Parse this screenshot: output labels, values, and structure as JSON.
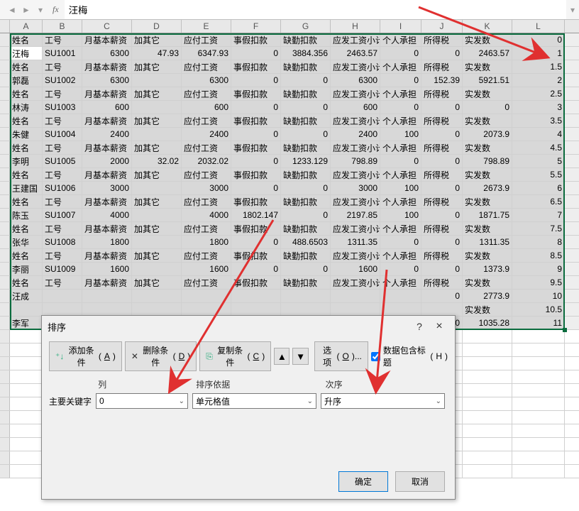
{
  "formula_bar": {
    "fx": "fx",
    "value": "汪梅"
  },
  "columns": [
    "A",
    "B",
    "C",
    "D",
    "E",
    "F",
    "G",
    "H",
    "I",
    "J",
    "K",
    "L"
  ],
  "data_headers": [
    "姓名",
    "工号",
    "月基本薪资",
    "加其它",
    "应付工资",
    "事假扣款",
    "缺勤扣款",
    "应发工资小计",
    "个人承担",
    "所得税",
    "实发数"
  ],
  "rows": [
    [
      "姓名",
      "工号",
      "月基本薪资",
      "加其它",
      "应付工资",
      "事假扣款",
      "缺勤扣款",
      "应发工资小计",
      "个人承担",
      "所得税",
      "实发数",
      "0"
    ],
    [
      "汪梅",
      "SU1001",
      "6300",
      "47.93",
      "6347.93",
      "0",
      "3884.356",
      "2463.57",
      "0",
      "0",
      "2463.57",
      "1"
    ],
    [
      "姓名",
      "工号",
      "月基本薪资",
      "加其它",
      "应付工资",
      "事假扣款",
      "缺勤扣款",
      "应发工资小计",
      "个人承担",
      "所得税",
      "实发数",
      "1.5"
    ],
    [
      "郭磊",
      "SU1002",
      "6300",
      "",
      "6300",
      "0",
      "0",
      "6300",
      "0",
      "152.39",
      "5921.51",
      "2"
    ],
    [
      "姓名",
      "工号",
      "月基本薪资",
      "加其它",
      "应付工资",
      "事假扣款",
      "缺勤扣款",
      "应发工资小计",
      "个人承担",
      "所得税",
      "实发数",
      "2.5"
    ],
    [
      "林涛",
      "SU1003",
      "600",
      "",
      "600",
      "0",
      "0",
      "600",
      "0",
      "0",
      "0",
      "3"
    ],
    [
      "姓名",
      "工号",
      "月基本薪资",
      "加其它",
      "应付工资",
      "事假扣款",
      "缺勤扣款",
      "应发工资小计",
      "个人承担",
      "所得税",
      "实发数",
      "3.5"
    ],
    [
      "朱健",
      "SU1004",
      "2400",
      "",
      "2400",
      "0",
      "0",
      "2400",
      "100",
      "0",
      "2073.9",
      "4"
    ],
    [
      "姓名",
      "工号",
      "月基本薪资",
      "加其它",
      "应付工资",
      "事假扣款",
      "缺勤扣款",
      "应发工资小计",
      "个人承担",
      "所得税",
      "实发数",
      "4.5"
    ],
    [
      "李明",
      "SU1005",
      "2000",
      "32.02",
      "2032.02",
      "0",
      "1233.129",
      "798.89",
      "0",
      "0",
      "798.89",
      "5"
    ],
    [
      "姓名",
      "工号",
      "月基本薪资",
      "加其它",
      "应付工资",
      "事假扣款",
      "缺勤扣款",
      "应发工资小计",
      "个人承担",
      "所得税",
      "实发数",
      "5.5"
    ],
    [
      "王建国",
      "SU1006",
      "3000",
      "",
      "3000",
      "0",
      "0",
      "3000",
      "100",
      "0",
      "2673.9",
      "6"
    ],
    [
      "姓名",
      "工号",
      "月基本薪资",
      "加其它",
      "应付工资",
      "事假扣款",
      "缺勤扣款",
      "应发工资小计",
      "个人承担",
      "所得税",
      "实发数",
      "6.5"
    ],
    [
      "陈玉",
      "SU1007",
      "4000",
      "",
      "4000",
      "1802.147",
      "0",
      "2197.85",
      "100",
      "0",
      "1871.75",
      "7"
    ],
    [
      "姓名",
      "工号",
      "月基本薪资",
      "加其它",
      "应付工资",
      "事假扣款",
      "缺勤扣款",
      "应发工资小计",
      "个人承担",
      "所得税",
      "实发数",
      "7.5"
    ],
    [
      "张华",
      "SU1008",
      "1800",
      "",
      "1800",
      "0",
      "488.6503",
      "1311.35",
      "0",
      "0",
      "1311.35",
      "8"
    ],
    [
      "姓名",
      "工号",
      "月基本薪资",
      "加其它",
      "应付工资",
      "事假扣款",
      "缺勤扣款",
      "应发工资小计",
      "个人承担",
      "所得税",
      "实发数",
      "8.5"
    ],
    [
      "李丽",
      "SU1009",
      "1600",
      "",
      "1600",
      "0",
      "0",
      "1600",
      "0",
      "0",
      "1373.9",
      "9"
    ],
    [
      "姓名",
      "工号",
      "月基本薪资",
      "加其它",
      "应付工资",
      "事假扣款",
      "缺勤扣款",
      "应发工资小计",
      "个人承担",
      "所得税",
      "实发数",
      "9.5"
    ],
    [
      "汪成",
      "",
      "",
      "",
      "",
      "",
      "",
      "",
      "",
      "0",
      "2773.9",
      "10"
    ],
    [
      "",
      "",
      "",
      "",
      "",
      "",
      "",
      "",
      "",
      "",
      "实发数",
      "10.5"
    ],
    [
      "李军",
      "",
      "",
      "",
      "",
      "",
      "",
      "",
      "",
      "0",
      "1035.28",
      "11"
    ]
  ],
  "dialog": {
    "title": "排序",
    "add_cond": "添加条件",
    "add_key": "A",
    "del_cond": "删除条件",
    "del_key": "D",
    "copy_cond": "复制条件",
    "copy_key": "C",
    "options": "选项",
    "options_key": "O",
    "has_header": "数据包含标题",
    "has_header_key": "H",
    "col_lbl": "列",
    "basis_lbl": "排序依据",
    "order_lbl": "次序",
    "main_key": "主要关键字",
    "key_value": "0",
    "basis_value": "单元格值",
    "order_value": "升序",
    "ok": "确定",
    "cancel": "取消"
  }
}
